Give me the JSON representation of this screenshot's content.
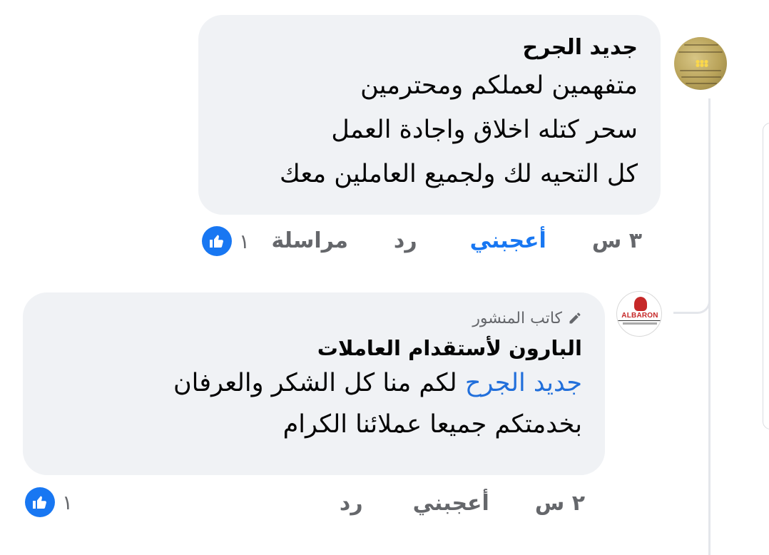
{
  "comments": [
    {
      "author": "جديد الجرح",
      "lines": [
        "متفهمين لعملكم ومحترمين",
        "سحر كتله اخلاق واجادة العمل",
        "كل التحيه لك ولجميع العاملين معك"
      ],
      "actions": {
        "time": "٣ س",
        "like": "أعجبني",
        "reply": "رد",
        "message": "مراسلة"
      },
      "reaction_count": "١"
    }
  ],
  "reply": {
    "badge": "كاتب المنشور",
    "author": "البارون لأستقدام العاملات",
    "mention": "جديد الجرح",
    "line1_rest": " لكم منا كل الشكر والعرفان",
    "line2": "بخدمتكم جميعا عملائنا الكرام",
    "actions": {
      "time": "٢ س",
      "like": "أعجبني",
      "reply": "رد"
    },
    "reaction_count": "١",
    "avatar_brand": "ALBARON"
  },
  "icons": {
    "badge": "pencil-icon",
    "reaction": "thumbs-up-icon"
  },
  "colors": {
    "bubble": "#f0f2f5",
    "link": "#1877f2",
    "mention": "#216fdb",
    "muted": "#65676b"
  }
}
